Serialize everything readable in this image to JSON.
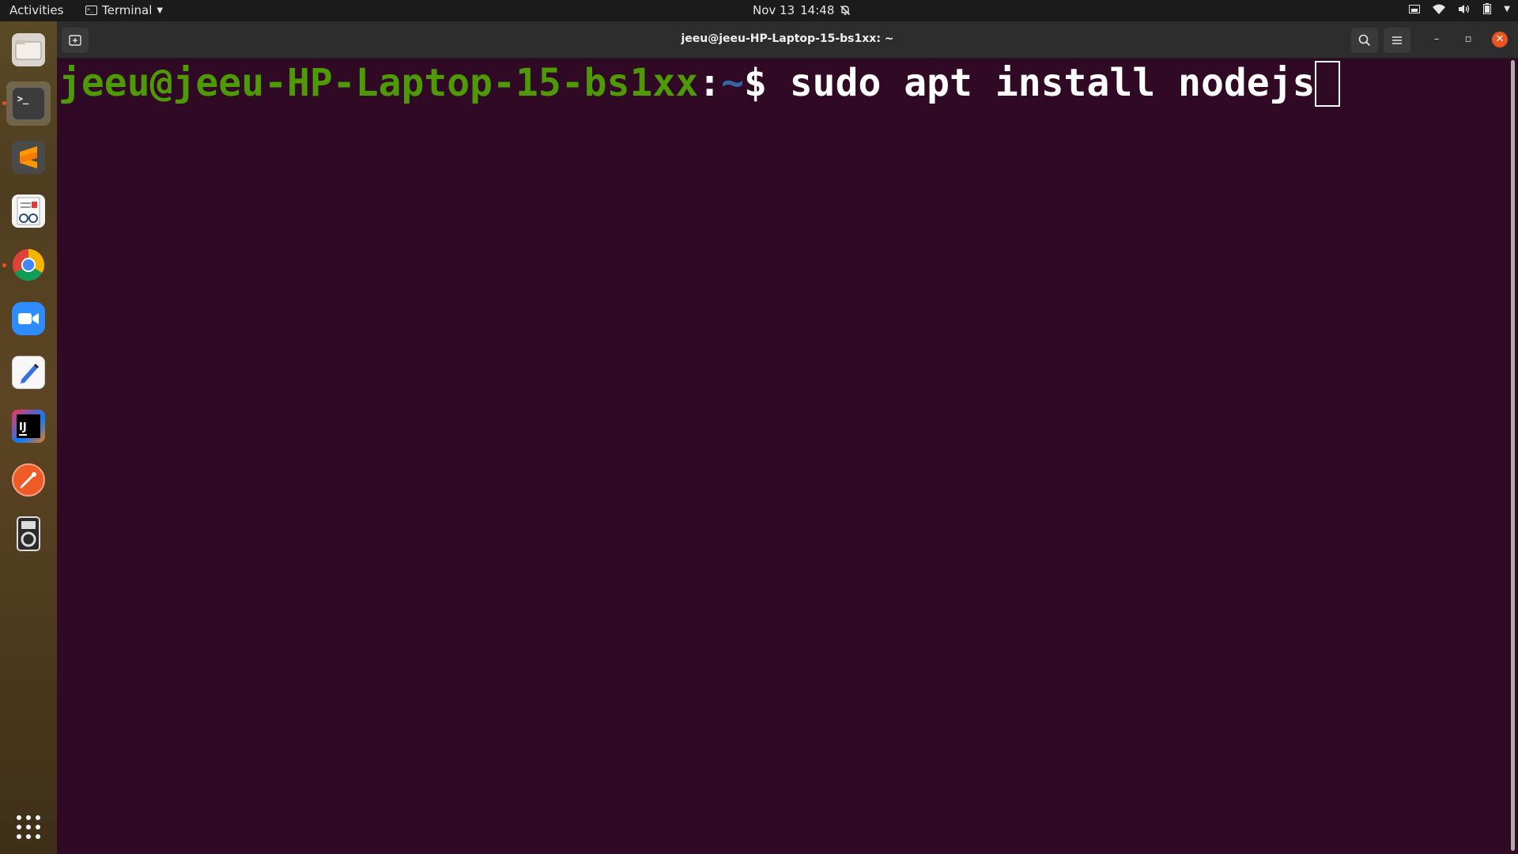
{
  "topbar": {
    "activities_label": "Activities",
    "app_menu_label": "Terminal",
    "date": "Nov 13",
    "time": "14:48",
    "tray_icons": [
      "screen-share-icon",
      "wifi-icon",
      "volume-icon",
      "battery-icon",
      "system-menu-caret-icon"
    ]
  },
  "dock": {
    "items": [
      {
        "name": "files",
        "running": false,
        "active": false
      },
      {
        "name": "terminal",
        "running": true,
        "active": true
      },
      {
        "name": "sublime-text",
        "running": false,
        "active": false
      },
      {
        "name": "document-viewer",
        "running": false,
        "active": false
      },
      {
        "name": "google-chrome",
        "running": true,
        "active": false
      },
      {
        "name": "zoom",
        "running": false,
        "active": false
      },
      {
        "name": "text-editor",
        "running": false,
        "active": false
      },
      {
        "name": "intellij-idea",
        "running": false,
        "active": false
      },
      {
        "name": "postman",
        "running": false,
        "active": false
      },
      {
        "name": "media-player",
        "running": false,
        "active": false
      }
    ],
    "show_apps_icon": "app-grid-icon"
  },
  "window": {
    "title": "jeeu@jeeu-HP-Laptop-15-bs1xx: ~",
    "new_tab_icon": "new-tab-icon",
    "search_icon": "search-icon",
    "menu_icon": "hamburger-menu-icon",
    "minimize_label": "–",
    "restore_label": "▫",
    "close_label": "✕"
  },
  "terminal": {
    "prompt_user_host": "jeeu@jeeu-HP-Laptop-15-bs1xx",
    "prompt_colon": ":",
    "prompt_path": "~",
    "prompt_symbol": "$ ",
    "command": "sudo apt install nodejs"
  },
  "colors": {
    "terminal_bg": "#300a24",
    "prompt_green": "#4e9a06",
    "prompt_blue": "#3465a4",
    "accent_orange": "#e95420"
  }
}
